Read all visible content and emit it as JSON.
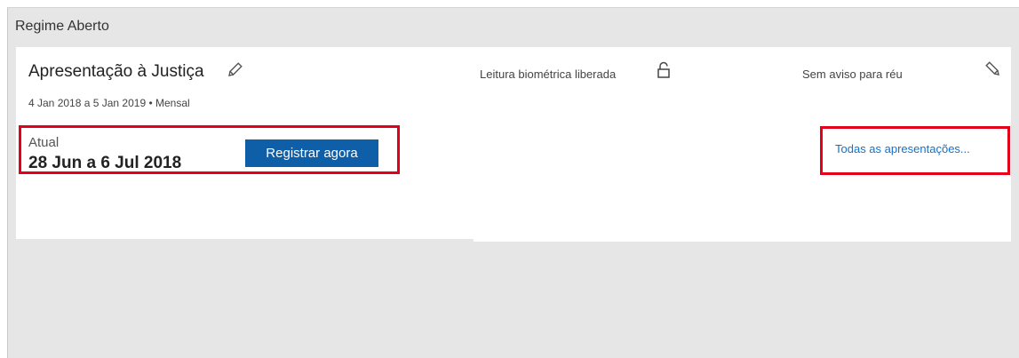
{
  "section": {
    "title": "Regime Aberto"
  },
  "card": {
    "title": "Apresentação à Justiça",
    "date_range": "4 Jan 2018 a 5 Jan 2019 • Mensal",
    "biometric_label": "Leitura biométrica liberada",
    "notice_label": "Sem aviso para réu",
    "current": {
      "label": "Atual",
      "period": "28 Jun a 6 Jul 2018",
      "register_button": "Registrar agora"
    },
    "all_presentations_link": "Todas as apresentações..."
  },
  "icons": {
    "title_edit": "pencil-icon",
    "biometric": "unlocked-padlock-icon",
    "notice_edit": "pencil-icon"
  },
  "colors": {
    "primary_button": "#0f5fa8",
    "link": "#1570c9",
    "highlight_border": "#e2001a",
    "background": "#e6e6e6"
  }
}
